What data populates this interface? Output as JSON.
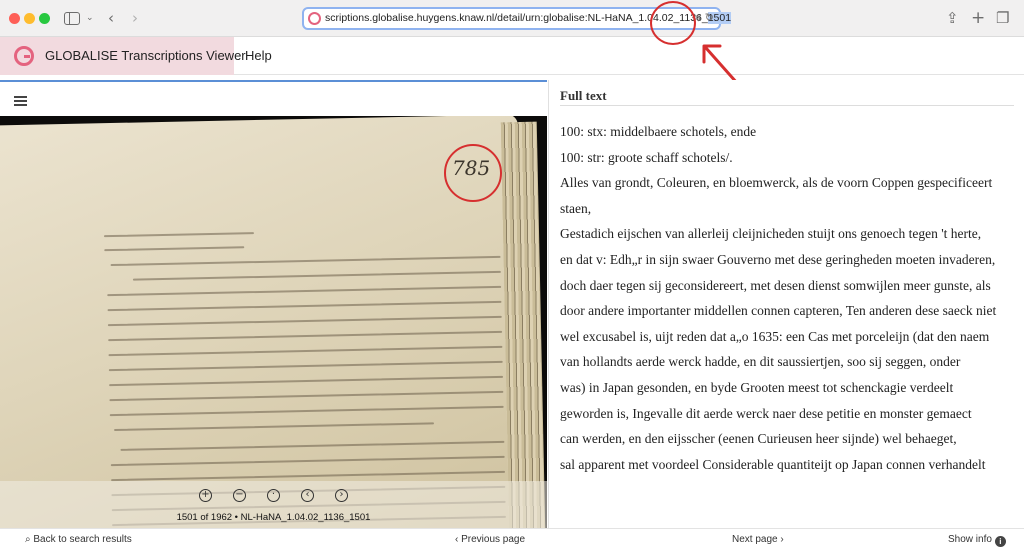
{
  "browser": {
    "url_prefix": "scriptions.globalise.huygens.knaw.nl/detail/urn:globalise:NL-HaNA_1.04.02_1136_",
    "url_highlight": "1501"
  },
  "header": {
    "app_title": "GLOBALISE Transcriptions Viewer",
    "help_label": "Help"
  },
  "image_pane": {
    "page_number_written": "785",
    "caption": "1501 of 1962 • NL-HaNA_1.04.02_1136_1501"
  },
  "fulltext": {
    "title": "Full text",
    "lines": [
      "100: stx: middelbaere schotels, ende",
      "100: str: groote schaff schotels/.",
      "Alles van grondt, Coleuren, en bloemwerck, als de voorn Coppen gespecificeert staen,",
      "Gestadich eijschen van allerleij cleijnicheden stuijt ons genoech tegen 't herte,",
      "en dat v: Edh„r in sijn swaer Gouverno met dese geringheden moeten invaderen,",
      "doch daer tegen sij geconsidereert, met desen dienst somwijlen meer gunste, als",
      "door andere importanter middellen connen capteren, Ten anderen dese saeck niet",
      "wel excusabel is, uijt reden dat a„o 1635: een Cas met porceleijn (dat den naem",
      "van hollandts aerde werck hadde, en dit saussiertjen, soo sij seggen, onder",
      "was) in Japan gesonden, en byde Grooten meest tot schenckagie verdeelt",
      "geworden is, Ingevalle dit aerde werck naer dese petitie en monster gemaect",
      "can werden, en den eijsscher (eenen Curieusen heer sijnde) wel behaeget,",
      "sal apparent met voordeel Considerable quantiteijt op Japan connen verhandelt"
    ]
  },
  "bottombar": {
    "back_label": "Back to search results",
    "prev_label": "Previous page",
    "next_label": "Next page",
    "info_label": "Show info"
  },
  "colors": {
    "brand_pink": "#e4637f",
    "brand_bg": "#f2dadf",
    "annotation_red": "#d62f2f",
    "pane_accent": "#5b8fd6"
  }
}
